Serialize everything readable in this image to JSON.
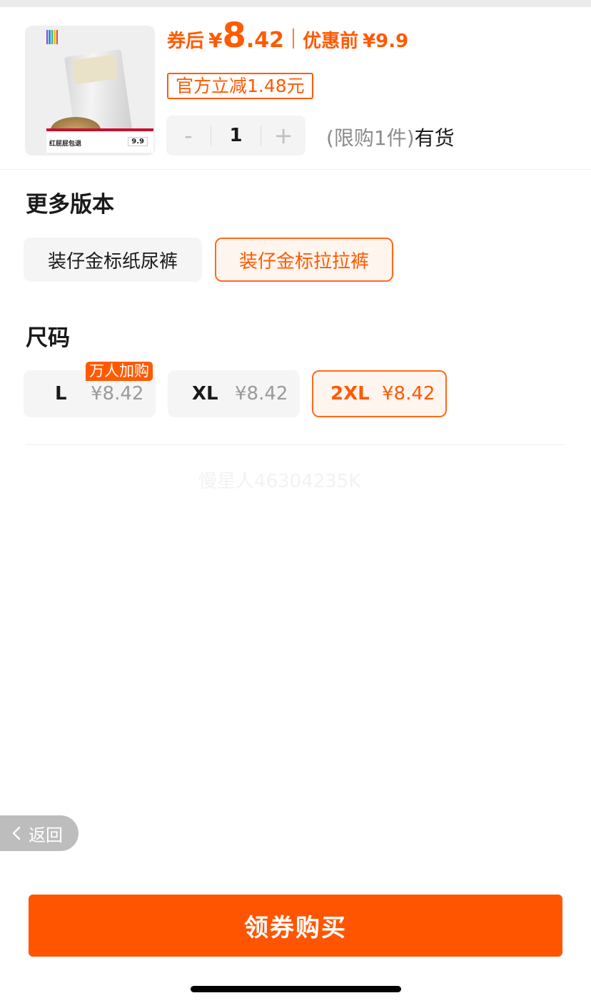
{
  "product": {
    "price_after_label": "券后",
    "currency": "¥",
    "price_after_int": "8",
    "price_after_dec": ".42",
    "price_before_label": "优惠前",
    "price_before": "¥9.9",
    "discount_tag": "官方立减1.48元",
    "thumbnail": {
      "band_title": "红屁屁包退",
      "band_price": "9.9"
    }
  },
  "quantity": {
    "minus_label": "-",
    "value": "1",
    "plus_label": "+",
    "limit_note": "(限购1件)",
    "stock_status": "有货"
  },
  "versions": {
    "title": "更多版本",
    "options": [
      {
        "label": "装仔金标纸尿裤",
        "selected": false
      },
      {
        "label": "装仔金标拉拉裤",
        "selected": true
      }
    ]
  },
  "sizes": {
    "title": "尺码",
    "badge": "万人加购",
    "options": [
      {
        "name": "L",
        "price": "¥8.42",
        "selected": false
      },
      {
        "name": "XL",
        "price": "¥8.42",
        "selected": false
      },
      {
        "name": "2XL",
        "price": "¥8.42",
        "selected": true
      }
    ]
  },
  "watermark": "慢星人46304235K",
  "back_label": "返回",
  "buy_button_label": "领券购买",
  "colors": {
    "accent": "#ff5a00",
    "buy_button": "#ff5500",
    "selected_border": "#ff6a1a",
    "chip_bg": "#f5f5f5"
  }
}
